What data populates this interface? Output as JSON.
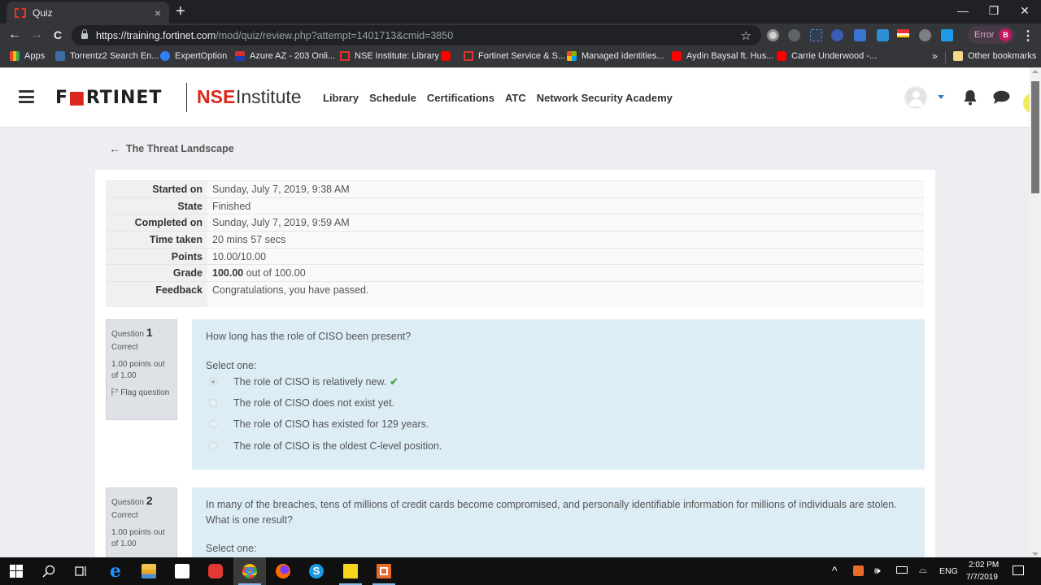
{
  "browser": {
    "tab_title": "Quiz",
    "tab_close": "×",
    "new_tab": "+",
    "window_controls": {
      "minimize": "—",
      "maximize": "❐",
      "close": "✕"
    },
    "nav": {
      "back": "←",
      "forward": "→",
      "reload": "C"
    },
    "url_host": "https://training.fortinet.com",
    "url_path": "/mod/quiz/review.php?attempt=1401713&cmid=3850",
    "star": "☆",
    "profile_status": "Error",
    "profile_initial": "B",
    "menu": "⋮",
    "bookmarks": [
      {
        "label": "Apps",
        "icon": "apps-icon"
      },
      {
        "label": "Torrentz2 Search En...",
        "icon": "torrentz-icon"
      },
      {
        "label": "ExpertOption",
        "icon": "expertoption-icon"
      },
      {
        "label": "Azure AZ - 203 Onli...",
        "icon": "dotnet-icon"
      },
      {
        "label": "NSE Institute: Library",
        "icon": "fortinet-icon"
      },
      {
        "label": "",
        "icon": "youtube-icon"
      },
      {
        "label": "Fortinet Service & S...",
        "icon": "fortinet-icon"
      },
      {
        "label": "Managed identities...",
        "icon": "microsoft-icon"
      },
      {
        "label": "Aydin Baysal ft. Hus...",
        "icon": "youtube-icon"
      },
      {
        "label": "Carrie Underwood -...",
        "icon": "youtube-icon"
      }
    ],
    "bookmarks_more": "»",
    "other_bookmarks": "Other bookmarks"
  },
  "site": {
    "logo_fortinet_pre": "F",
    "logo_fortinet_o": "■",
    "logo_fortinet_post": "RTINET",
    "logo_nse": "NSE",
    "logo_institute": "Institute",
    "nav": [
      "Library",
      "Schedule",
      "Certifications",
      "ATC",
      "Network Security Academy"
    ]
  },
  "breadcrumb": {
    "back_arrow": "🡐",
    "label": "The Threat Landscape"
  },
  "summary": [
    {
      "label": "Started on",
      "value": "Sunday, July 7, 2019, 9:38 AM"
    },
    {
      "label": "State",
      "value": "Finished"
    },
    {
      "label": "Completed on",
      "value": "Sunday, July 7, 2019, 9:59 AM"
    },
    {
      "label": "Time taken",
      "value": "20 mins 57 secs"
    },
    {
      "label": "Points",
      "value": "10.00/10.00"
    },
    {
      "label": "Grade",
      "value_bold": "100.00",
      "value": " out of 100.00"
    },
    {
      "label": "Feedback",
      "value": "Congratulations, you have passed."
    }
  ],
  "questions": [
    {
      "label": "Question",
      "number": "1",
      "state": "Correct",
      "grade": "1.00 points out of 1.00",
      "flag": "Flag question",
      "text": "How long has the role of CISO been present?",
      "prompt": "Select one:",
      "answers": [
        {
          "text": "The role of CISO is relatively new.",
          "selected": true,
          "correct_mark": "✔"
        },
        {
          "text": "The role of CISO does not exist yet.",
          "selected": false
        },
        {
          "text": "The role of CISO has existed for 129 years.",
          "selected": false
        },
        {
          "text": "The role of CISO is the oldest C-level position.",
          "selected": false
        }
      ]
    },
    {
      "label": "Question",
      "number": "2",
      "state": "Correct",
      "grade": "1.00 points out of 1.00",
      "text_line1": "In many of the breaches, tens of millions of credit cards become compromised, and personally identifiable information for millions of individuals are stolen.",
      "text_line2": "What is one result?",
      "prompt": "Select one:"
    }
  ],
  "taskbar": {
    "tray_caret": "^",
    "lang": "ENG",
    "time": "2:02 PM",
    "date": "7/7/2019"
  },
  "colors": {
    "brand_red": "#da291c",
    "question_bg": "#dcedf5",
    "info_bg": "#dee2e6",
    "correct_green": "#4ca44c"
  }
}
